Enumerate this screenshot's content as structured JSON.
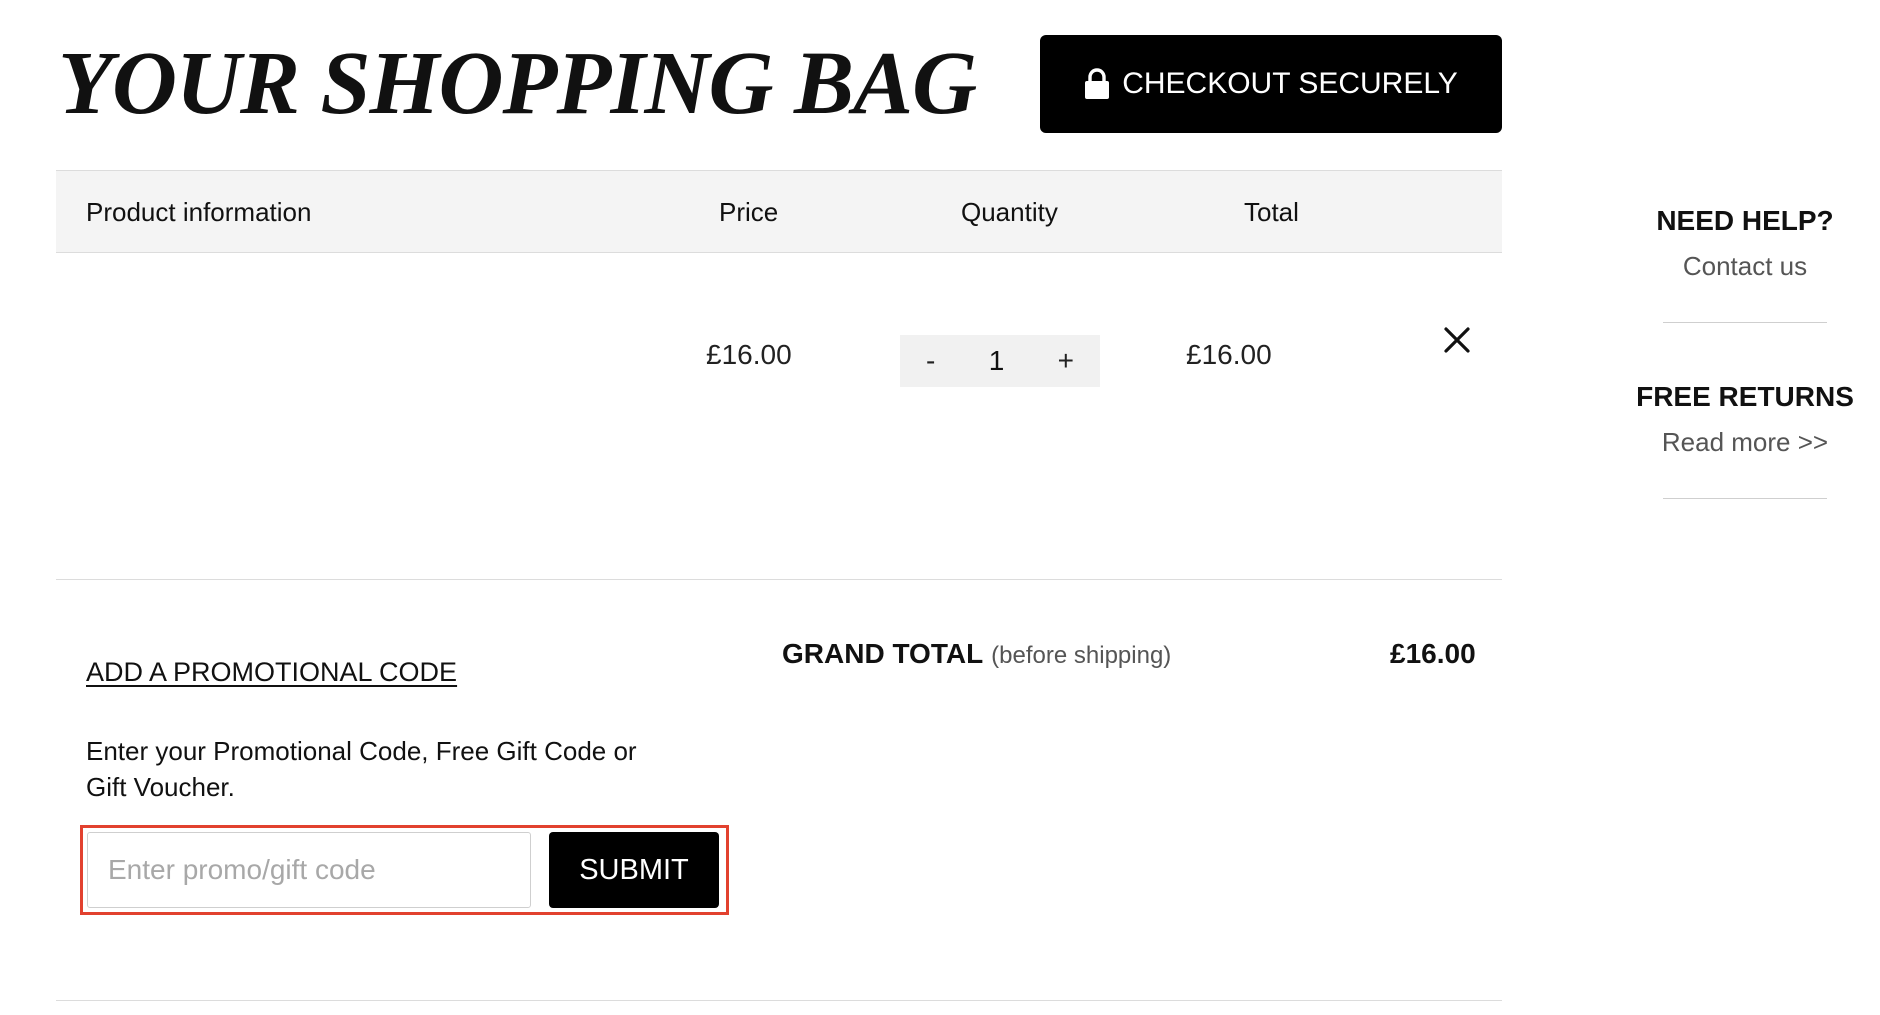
{
  "header": {
    "title": "YOUR SHOPPING BAG",
    "checkout_label": "CHECKOUT SECURELY"
  },
  "table": {
    "columns": [
      "Product information",
      "Price",
      "Quantity",
      "Total"
    ],
    "rows": [
      {
        "product": "",
        "price": "£16.00",
        "quantity": "1",
        "total": "£16.00"
      }
    ],
    "qty_minus": "-",
    "qty_plus": "+"
  },
  "promo": {
    "link_label": "ADD A PROMOTIONAL CODE",
    "description": "Enter your Promotional Code, Free Gift Code or Gift Voucher.",
    "placeholder": "Enter promo/gift code",
    "submit_label": "SUBMIT"
  },
  "totals": {
    "grand_total_label": "GRAND TOTAL",
    "grand_total_note": "(before shipping)",
    "grand_total_value": "£16.00"
  },
  "side": {
    "help_title": "NEED HELP?",
    "help_link": "Contact us",
    "returns_title": "FREE RETURNS",
    "returns_link": "Read more >>"
  },
  "colors": {
    "accent": "#000000",
    "highlight_border": "#e2412f",
    "header_bg": "#f4f4f4"
  }
}
